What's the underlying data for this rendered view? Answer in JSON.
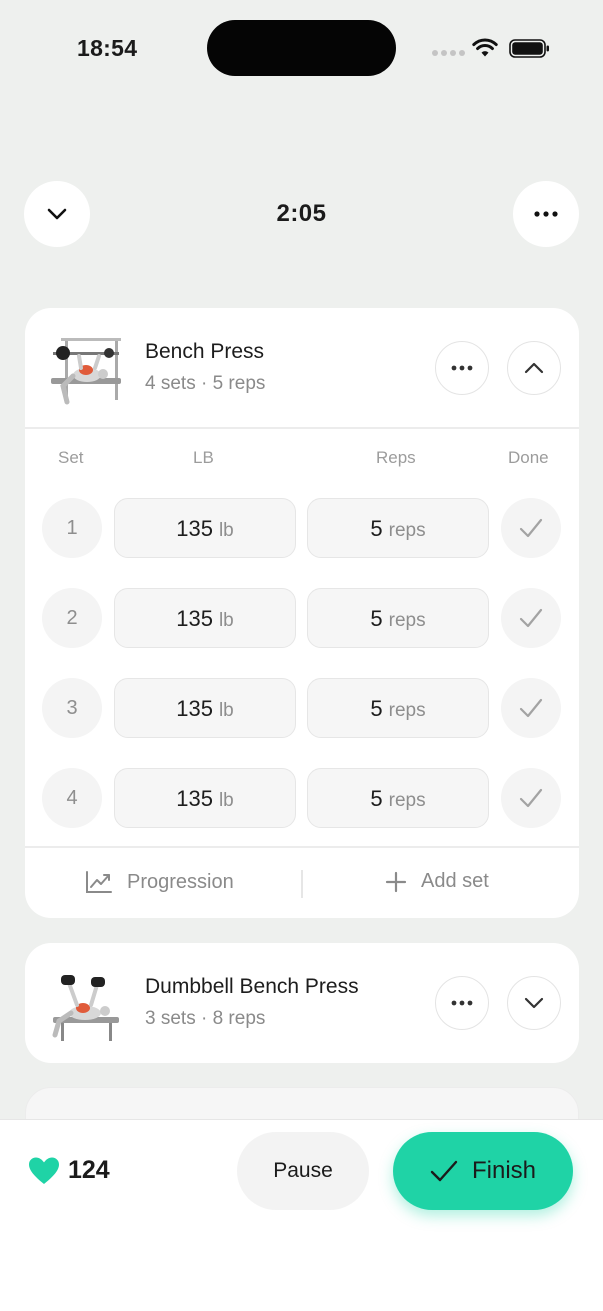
{
  "status_bar": {
    "time": "18:54"
  },
  "header": {
    "timer": "2:05"
  },
  "exercises": [
    {
      "name": "Bench Press",
      "summary": "4 sets · 5 reps",
      "columns": {
        "set": "Set",
        "weight": "LB",
        "reps": "Reps",
        "done": "Done"
      },
      "sets": [
        {
          "num": "1",
          "weight": "135",
          "weight_unit": "lb",
          "reps": "5",
          "reps_unit": "reps"
        },
        {
          "num": "2",
          "weight": "135",
          "weight_unit": "lb",
          "reps": "5",
          "reps_unit": "reps"
        },
        {
          "num": "3",
          "weight": "135",
          "weight_unit": "lb",
          "reps": "5",
          "reps_unit": "reps"
        },
        {
          "num": "4",
          "weight": "135",
          "weight_unit": "lb",
          "reps": "5",
          "reps_unit": "reps"
        }
      ],
      "progression_label": "Progression",
      "add_set_label": "Add set"
    },
    {
      "name": "Dumbbell Bench Press",
      "summary": "3 sets · 8 reps"
    }
  ],
  "bottom_bar": {
    "heart_rate": "124",
    "pause_label": "Pause",
    "finish_label": "Finish"
  },
  "colors": {
    "accent": "#1fd3a6",
    "background": "#eef0ee"
  }
}
